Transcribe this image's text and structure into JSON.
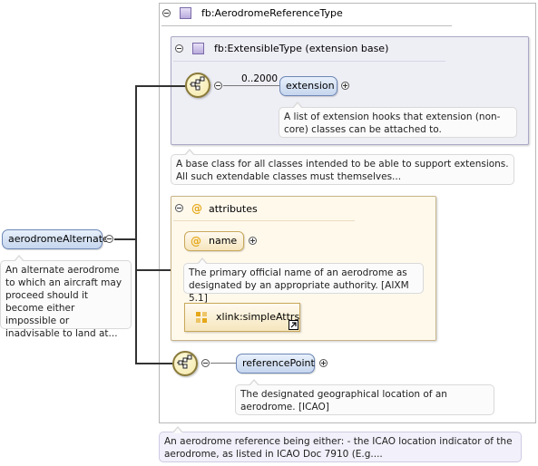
{
  "root": {
    "name": "aerodromeAlternate",
    "documentation": "An alternate aerodrome to which an aircraft may proceed should it become either impossible or inadvisable to land at..."
  },
  "type": {
    "name": "fb:AerodromeReferenceType",
    "documentation": "An aerodrome reference being either: - the ICAO location indicator of the aerodrome, as listed in ICAO Doc 7910 (E.g...."
  },
  "extensible": {
    "name": "fb:ExtensibleType (extension base)",
    "cardinality": "0..2000",
    "element": "extension",
    "element_documentation": "A list of extension hooks that extension (non-core) classes can be attached to.",
    "documentation": "A base class for all classes intended to be able to support extensions. All such extendable classes must themselves..."
  },
  "attributes": {
    "title": "attributes",
    "at_symbol": "@",
    "name_attr": "name",
    "name_documentation": "The primary official name of an aerodrome as designated by an appropriate authority. [AIXM 5.1]",
    "group": "xlink:simpleAttrs"
  },
  "reference_point": {
    "element": "referencePoint",
    "documentation": "The designated geographical location of an aerodrome. [ICAO]"
  },
  "colors": {
    "type_panel_bg": "#ffffff",
    "ext_panel_bg": "#eeeef5",
    "attr_panel_bg": "#fff9ec",
    "element_fill": "#c6d6ee",
    "attr_accent": "#e5a81a"
  }
}
